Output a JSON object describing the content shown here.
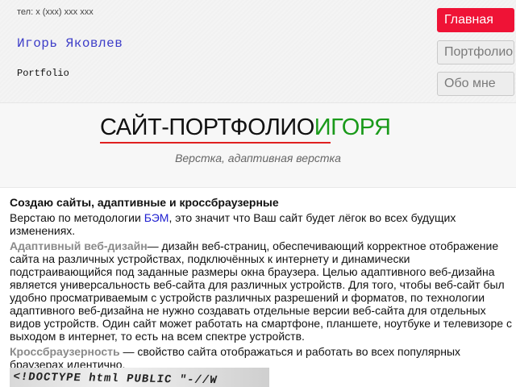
{
  "header": {
    "phone": "тел: x (xxx) xxx xxx",
    "name": "Игорь Яковлев",
    "portfolio_label": "Portfolio"
  },
  "nav": {
    "items": [
      {
        "label": "Главная",
        "active": true
      },
      {
        "label": "Портфолио",
        "active": false
      },
      {
        "label": "Обо мне",
        "active": false
      }
    ]
  },
  "hero": {
    "title_part1": "САЙТ-ПОРТФОЛИО",
    "title_part2": "ИГОРЯ",
    "subtitle": "Верстка, адаптивная верстка"
  },
  "content": {
    "heading": "Создаю сайты, адаптивные и кроссбраузерные",
    "p1_before": "Верстаю по методологии ",
    "p1_link": "БЭМ",
    "p1_after": ", это значит что Ваш сайт будет лёгок во всех будущих изменениях.",
    "p2_term": "Адаптивный веб-дизайн",
    "p2_text": "— дизайн веб-страниц, обеспечивающий корректное отображение сайта на различных устройствах, подключённых к интернету и динамически подстраивающийся под заданные размеры окна браузера. Целью адаптивного веб-дизайна является универсальность веб-сайта для различных устройств. Для того, чтобы веб-сайт был удобно просматриваемым с устройств различных разрешений и форматов, по технологии адаптивного веб-дизайна не нужно создавать отдельные версии веб-сайта для отдельных видов устройств. Один сайт может работать на смартфоне, планшете, ноутбуке и телевизоре с выходом в интернет, то есть на всем спектре устройств.",
    "p3_term": "Кроссбраузерность",
    "p3_text": " — свойство сайта отображаться и работать во всех популярных браузерах идентично.",
    "image_text": "<!DOCTYPE html PUBLIC \"-//W"
  },
  "colors": {
    "accent": "#ef1336",
    "title_green": "#1a9a1a",
    "underline_red": "#e02020",
    "link_blue": "#2020d0"
  }
}
